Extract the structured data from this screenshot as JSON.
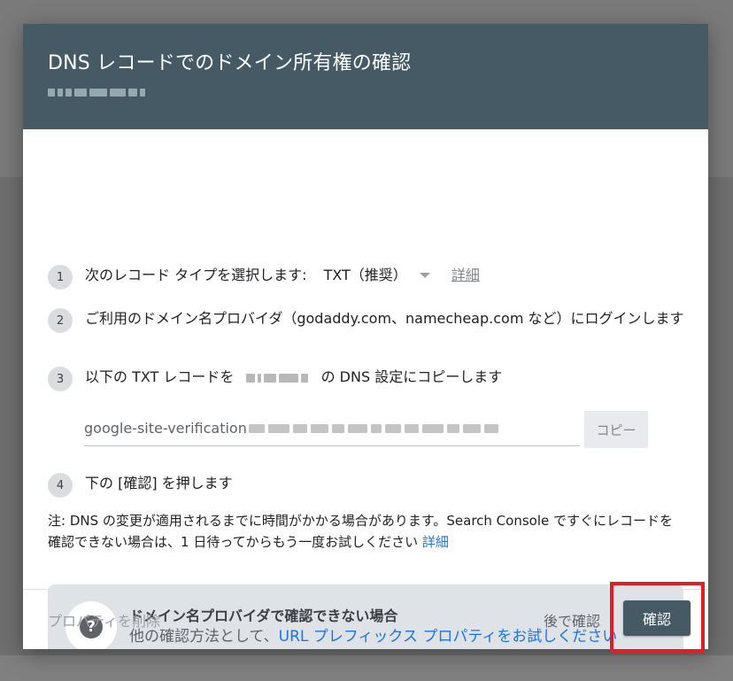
{
  "dialog": {
    "title": "DNS レコードでのドメイン所有権の確認",
    "steps": [
      {
        "num": "1",
        "text": "次のレコード タイプを選択します:",
        "select_value": "TXT（推奨）",
        "details_link": "詳細"
      },
      {
        "num": "2",
        "text": "ご利用のドメイン名プロバイダ（godaddy.com、namecheap.com など）にログインします"
      },
      {
        "num": "3",
        "text_before": "以下の TXT レコードを",
        "text_after": "の DNS 設定にコピーします"
      },
      {
        "num": "4",
        "text": "下の [確認] を押します"
      }
    ],
    "txt_record_prefix": "google-site-verification",
    "copy_label": "コピー",
    "note_text": "注: DNS の変更が適用されるまでに時間がかかる場合があります。Search Console ですぐにレコードを確認できない場合は、1 日待ってからもう一度お試しください",
    "note_link": "詳細",
    "help": {
      "icon": "question-mark",
      "title": "ドメイン名プロバイダで確認できない場合",
      "line_prefix": "他の確認方法として、",
      "line_link": "URL プレフィックス プロパティをお試しください"
    },
    "footer": {
      "delete_label": "プロパティを削除",
      "later_label": "後で確認",
      "confirm_label": "確認"
    }
  },
  "colors": {
    "header_bg": "#455a64",
    "link_blue": "#1a73e8",
    "highlight_red": "#e01e27",
    "help_box_bg": "#dfe3e8"
  }
}
